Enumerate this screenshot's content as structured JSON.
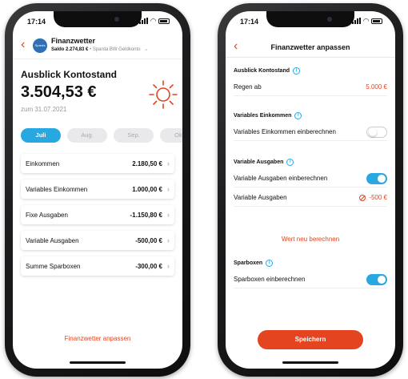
{
  "status_bar": {
    "time": "17:14"
  },
  "left": {
    "account": {
      "name": "Finanzwetter",
      "balance_label": "Saldo",
      "balance": "2.274,83 €",
      "bank": "• Sparda BW Geldkonto"
    },
    "overview_title": "Ausblick Kontostand",
    "projected_balance": "3.504,53 €",
    "date": "zum 31.07.2021",
    "months": [
      {
        "label": "Juli",
        "active": true
      },
      {
        "label": "Aug.",
        "active": false
      },
      {
        "label": "Sep.",
        "active": false
      },
      {
        "label": "Okt.",
        "active": false
      }
    ],
    "rows": [
      {
        "label": "Einkommen",
        "value": "2.180,50 €"
      },
      {
        "label": "Variables Einkommen",
        "value": "1.000,00 €"
      },
      {
        "label": "Fixe Ausgaben",
        "value": "-1.150,80 €"
      },
      {
        "label": "Variable Ausgaben",
        "value": "-500,00 €"
      },
      {
        "label": "Summe Sparboxen",
        "value": "-300,00 €"
      }
    ],
    "adjust_link": "Finanzwetter anpassen",
    "weather_icon": "sun-icon"
  },
  "right": {
    "title": "Finanzwetter anpassen",
    "sections": {
      "overview": {
        "title": "Ausblick Kontostand",
        "rain_label": "Regen ab",
        "rain_value": "5.000 €"
      },
      "variable_income": {
        "title": "Variables Einkommen",
        "toggle_label": "Variables Einkommen einberechnen",
        "enabled": false
      },
      "variable_expenses": {
        "title": "Variable Ausgaben",
        "toggle_label": "Variable Ausgaben einberechnen",
        "enabled": true,
        "value_label": "Variable Ausgaben",
        "value": "-500 €"
      },
      "savings": {
        "title": "Sparboxen",
        "toggle_label": "Sparboxen einberechnen",
        "enabled": true
      }
    },
    "recalc_link": "Wert neu berechnen",
    "save_label": "Speichern"
  },
  "colors": {
    "accent": "#e4441f",
    "primary": "#29a7e1"
  }
}
